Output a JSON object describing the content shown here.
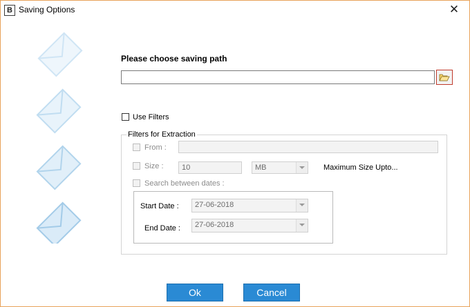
{
  "window": {
    "title": "Saving Options",
    "icon_letter": "B",
    "close_glyph": "✕"
  },
  "path": {
    "label": "Please choose saving path",
    "value": ""
  },
  "use_filters": {
    "label": "Use Filters",
    "checked": false
  },
  "filters": {
    "group_title": "Filters for Extraction",
    "from": {
      "label": "From :",
      "value": ""
    },
    "size": {
      "label": "Size :",
      "value": "10",
      "unit": "MB",
      "max_label": "Maximum Size Upto..."
    },
    "dates": {
      "label": "Search between dates :",
      "start_label": "Start Date :",
      "start_value": "27-06-2018",
      "end_label": "End Date :",
      "end_value": "27-06-2018"
    }
  },
  "buttons": {
    "ok": "Ok",
    "cancel": "Cancel"
  },
  "icons": {
    "app": "app-logo-icon",
    "close": "close-icon",
    "browse": "folder-open-icon",
    "decor": "envelope-icon"
  },
  "colors": {
    "accent": "#2a8ad4",
    "window_border": "#e8a25a",
    "browse_border": "#c0392b"
  }
}
